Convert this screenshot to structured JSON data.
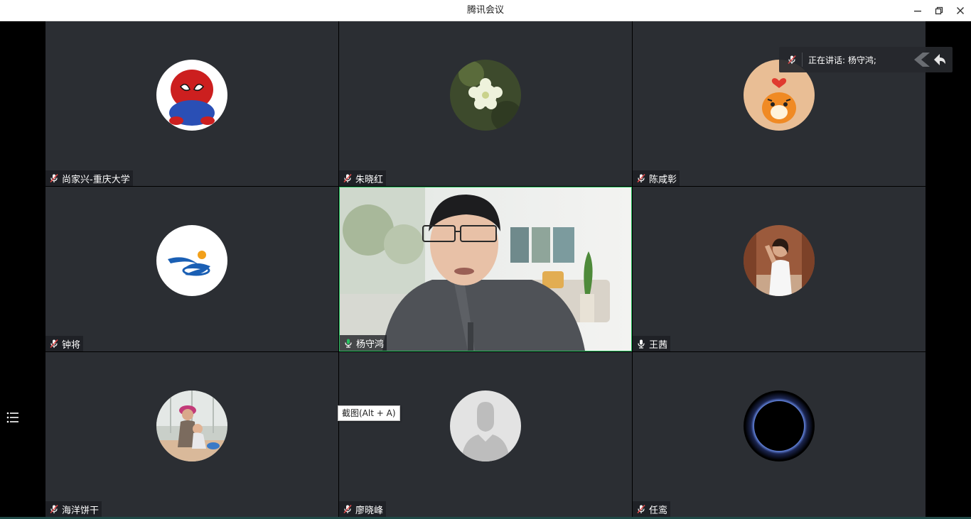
{
  "window": {
    "title": "腾讯会议",
    "controls": [
      "minimize-icon",
      "restore-icon",
      "close-icon"
    ]
  },
  "speaker_bar": {
    "text": "正在讲话: 杨守鸿;",
    "icons": [
      "mic-muted-icon",
      "arrow-back-icon"
    ]
  },
  "participants": [
    {
      "name": "尚家兴-重庆大学",
      "mic": "muted",
      "avatar": "spiderman-avatar"
    },
    {
      "name": "朱晓红",
      "mic": "muted",
      "avatar": "flower-avatar"
    },
    {
      "name": "陈咸彰",
      "mic": "muted",
      "avatar": "tiger-avatar"
    },
    {
      "name": "钟将",
      "mic": "muted",
      "avatar": "logo-avatar"
    },
    {
      "name": "杨守鸿",
      "mic": "speaking",
      "avatar": "video-feed"
    },
    {
      "name": "王茜",
      "mic": "on",
      "avatar": "photo-avatar"
    },
    {
      "name": "海洋饼干",
      "mic": "muted",
      "avatar": "family-photo-avatar"
    },
    {
      "name": "廖晓峰",
      "mic": "muted",
      "avatar": "default-avatar"
    },
    {
      "name": "任鸾",
      "mic": "muted",
      "avatar": "ring-avatar"
    }
  ],
  "tooltip": {
    "text": "截图(Alt + A)"
  },
  "colors": {
    "tile_bg": "#2b2e33",
    "active_border": "#29c060",
    "speaking_mic": "#29c060",
    "muted_mic": "#e04b4b"
  }
}
